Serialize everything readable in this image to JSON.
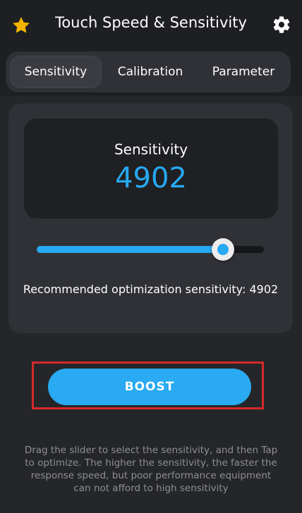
{
  "header": {
    "title": "Touch Speed & Sensitivity",
    "left_icon": "star-icon",
    "right_icon": "gear-icon"
  },
  "tabs": [
    {
      "label": "Sensitivity",
      "active": true
    },
    {
      "label": "Calibration",
      "active": false
    },
    {
      "label": "Parameter",
      "active": false
    }
  ],
  "display": {
    "label": "Sensitivity",
    "value": "4902"
  },
  "slider": {
    "fill_fraction": 0.82
  },
  "recommendation": "Recommended optimization sensitivity: 4902",
  "boost_label": "BOOST",
  "help_text": "Drag the slider to select the sensitivity, and then Tap to optimize. The higher the sensitivity, the faster the response speed, but poor performance equipment can not afford to high sensitivity",
  "colors": {
    "accent": "#27a9f3",
    "background": "#252629",
    "highlight_frame": "#d42a2a",
    "star": "#f5b301"
  }
}
